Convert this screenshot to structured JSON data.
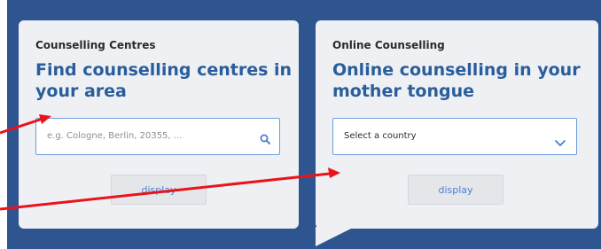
{
  "left_card": {
    "eyebrow": "Counselling Centres",
    "headline": "Find counselling centres in your area",
    "search": {
      "placeholder": "e.g. Cologne, Berlin, 20355, ..."
    },
    "button_label": "display",
    "icon": "search-icon"
  },
  "right_card": {
    "eyebrow": "Online Counselling",
    "headline": "Online counselling in your mother tongue",
    "select": {
      "value": "Select a country"
    },
    "button_label": "display",
    "icon": "chevron-down-icon"
  },
  "colors": {
    "background": "#2f5590",
    "card": "#eef0f4",
    "headline": "#2a5d9b",
    "accent": "#4a7fd1",
    "annotation_arrow": "#e8141c"
  }
}
